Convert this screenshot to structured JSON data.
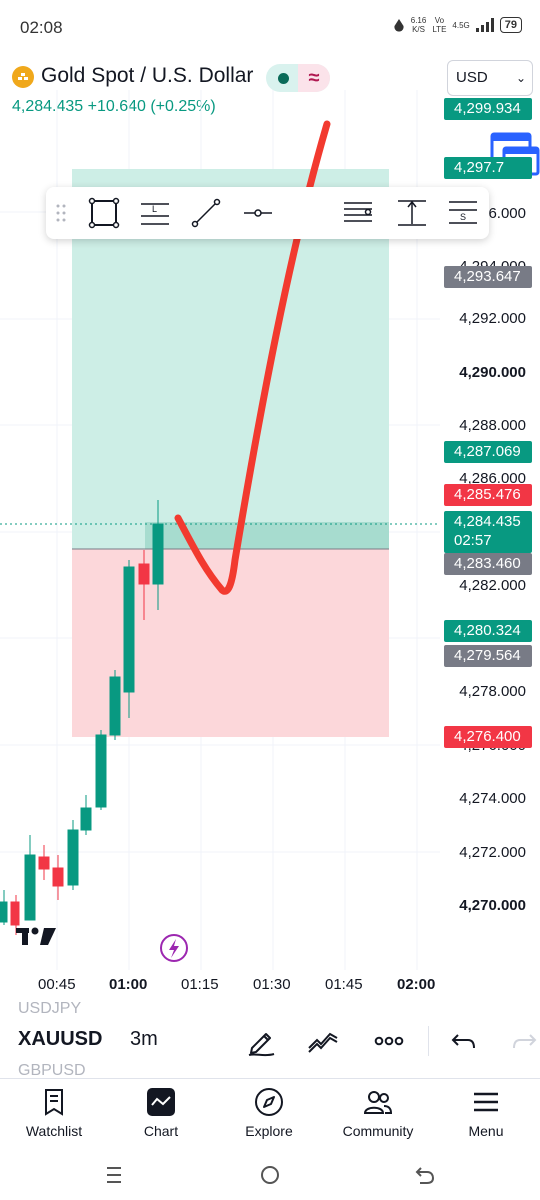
{
  "status_bar": {
    "time": "02:08",
    "speed": "6.16",
    "speed_unit": "K/S",
    "volte_top": "Vo",
    "volte_bottom": "LTE",
    "network": "4.5G",
    "battery": "79"
  },
  "header": {
    "symbol_name": "Gold Spot / U.S. Dollar",
    "price_change": "4,284.435  +10.640 (+0.25%)",
    "currency": "USD",
    "market_icon": "wave-icon"
  },
  "chart": {
    "axis_labels": [
      "4,296.000",
      "4,294.000",
      "4,292.000",
      "4,290.000",
      "4,288.000",
      "4,286.000",
      "4,282.000",
      "4,278.000",
      "4,276.000",
      "4,274.000",
      "4,272.000",
      "4,270.000"
    ],
    "price_tags": {
      "top": "4,299.934",
      "second": "4,297.7",
      "gray_upper": "4,293.647",
      "green_mid": "4,287.069",
      "red_mid": "4,285.476",
      "current": "4,284.435",
      "countdown": "02:57",
      "gray_entry": "4,283.460",
      "green_low": "4,280.324",
      "gray_low": "4,279.564",
      "stop": "4,276.400"
    },
    "time_labels": [
      "00:45",
      "01:00",
      "01:15",
      "01:30",
      "01:45",
      "02:00"
    ],
    "colors": {
      "up": "#089981",
      "down": "#f23645",
      "profit_zone": "#cdeee6",
      "loss_zone": "#fcd7da",
      "annotation": "#f23a2f"
    },
    "logo": "TV"
  },
  "symbol_bar": {
    "prev_symbol": "USDJPY",
    "symbol": "XAUUSD",
    "interval": "3m",
    "next_symbol": "GBPUSD"
  },
  "bottom_nav": {
    "items": [
      {
        "label": "Watchlist",
        "icon": "watchlist-icon"
      },
      {
        "label": "Chart",
        "icon": "chart-icon"
      },
      {
        "label": "Explore",
        "icon": "compass-icon"
      },
      {
        "label": "Community",
        "icon": "community-icon"
      },
      {
        "label": "Menu",
        "icon": "menu-icon"
      }
    ]
  }
}
